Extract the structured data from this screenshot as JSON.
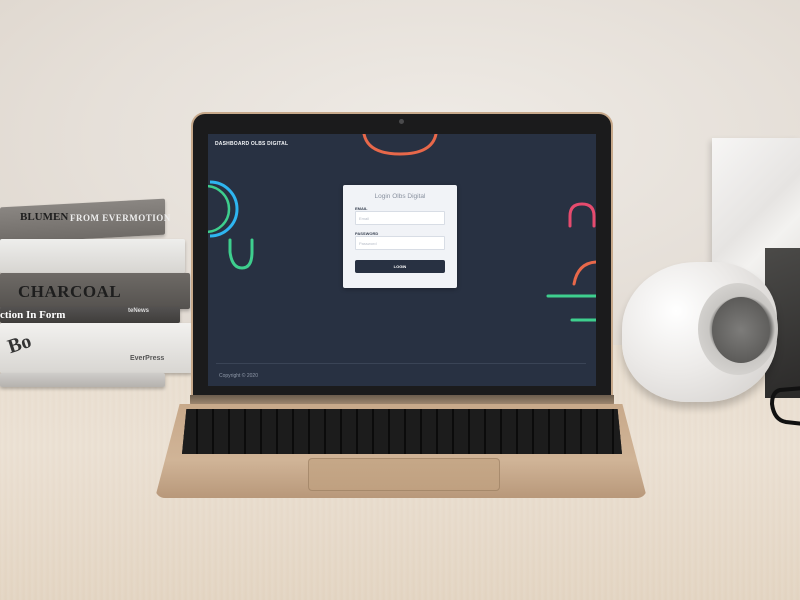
{
  "scene": {
    "book_titles": {
      "blumen": "BLUMEN",
      "evolution": "FROM EVERMOTION",
      "charcoal": "CHARCOAL",
      "taschen": "teNews",
      "in_form": "ction In Form",
      "eyeview": "EverPress",
      "bo": "Bo"
    }
  },
  "app": {
    "brand": "DASHBOARD OLBS DIGITAL",
    "login": {
      "title": "Login Olbs Digital",
      "email_label": "EMAIL",
      "email_placeholder": "Email",
      "password_label": "PASSWORD",
      "password_placeholder": "Password",
      "submit_label": "LOGIN"
    },
    "footer": "Copyright © 2020"
  },
  "colors": {
    "screen_background": "#283142",
    "card_background": "#f1f3f7",
    "accent_orange": "#e8684a",
    "accent_green": "#3ecf8e",
    "accent_blue": "#2eb5f0",
    "accent_pink": "#e64b6e"
  }
}
